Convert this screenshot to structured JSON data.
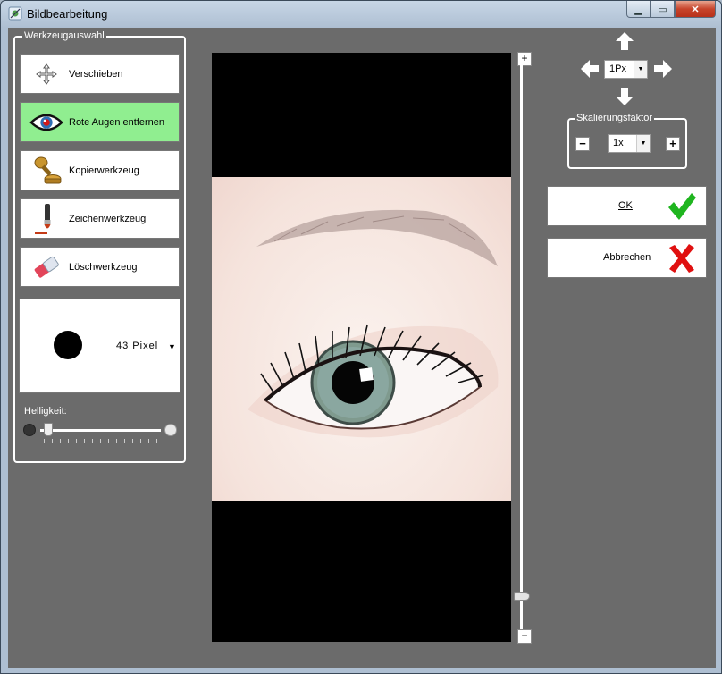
{
  "window": {
    "title": "Bildbearbeitung"
  },
  "tools": {
    "group_title": "Werkzeugauswahl",
    "items": [
      {
        "label": "Verschieben",
        "icon": "move-icon",
        "active": false
      },
      {
        "label": "Rote Augen entfernen",
        "icon": "eye-icon",
        "active": true
      },
      {
        "label": "Kopierwerkzeug",
        "icon": "stamp-icon",
        "active": false
      },
      {
        "label": "Zeichenwerkzeug",
        "icon": "brush-icon",
        "active": false
      },
      {
        "label": "Löschwerkzeug",
        "icon": "eraser-icon",
        "active": false
      }
    ],
    "brush_size": "43 Pixel",
    "brightness_label": "Helligkeit:"
  },
  "zoom": {
    "plus": "+",
    "minus": "−"
  },
  "nav": {
    "step_value": "1Px"
  },
  "scale": {
    "group_title": "Skalierungsfaktor",
    "value": "1x",
    "minus": "−",
    "plus": "+"
  },
  "actions": {
    "ok_label": "OK",
    "cancel_label": "Abbrechen"
  },
  "colors": {
    "background": "#6b6b6b",
    "active_tool": "#90ee90",
    "ok_check": "#1fb51f",
    "cancel_x": "#e01010"
  }
}
